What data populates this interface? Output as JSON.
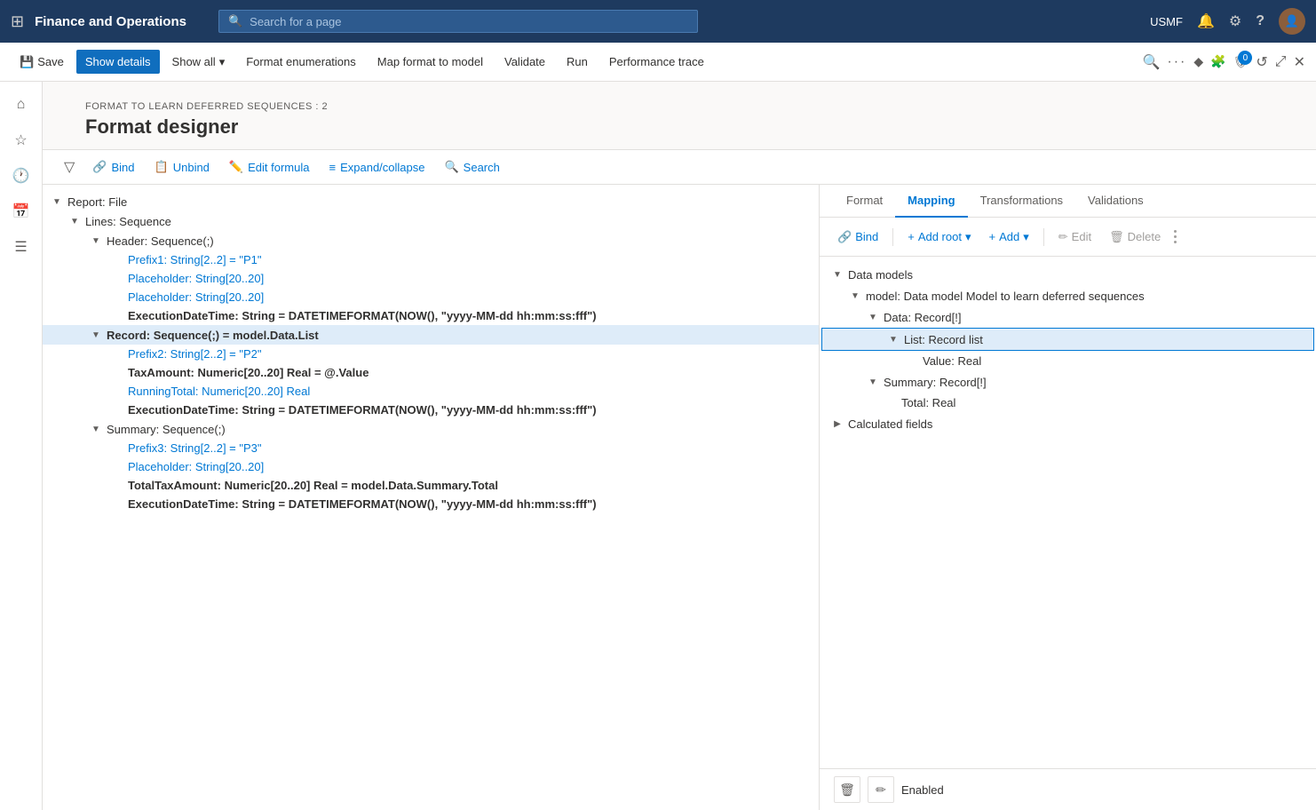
{
  "app": {
    "title": "Finance and Operations",
    "search_placeholder": "Search for a page",
    "user_code": "USMF"
  },
  "command_bar": {
    "save": "Save",
    "show_details": "Show details",
    "show_all": "Show all",
    "format_enumerations": "Format enumerations",
    "map_format_to_model": "Map format to model",
    "validate": "Validate",
    "run": "Run",
    "performance_trace": "Performance trace"
  },
  "breadcrumb": "FORMAT TO LEARN DEFERRED SEQUENCES : 2",
  "page_title": "Format designer",
  "toolbar": {
    "bind": "Bind",
    "unbind": "Unbind",
    "edit_formula": "Edit formula",
    "expand_collapse": "Expand/collapse",
    "search": "Search"
  },
  "format_tree": [
    {
      "id": "report",
      "label": "Report: File",
      "indent": 0,
      "collapsed": false,
      "bold": false,
      "children": [
        {
          "id": "lines",
          "label": "Lines: Sequence",
          "indent": 1,
          "collapsed": false,
          "children": [
            {
              "id": "header",
              "label": "Header: Sequence(;)",
              "indent": 2,
              "collapsed": false,
              "children": [
                {
                  "id": "prefix1",
                  "label": "Prefix1: String[2..2] = \"P1\"",
                  "indent": 3,
                  "leaf": true,
                  "blue": true
                },
                {
                  "id": "placeholder1",
                  "label": "Placeholder: String[20..20]",
                  "indent": 3,
                  "leaf": true,
                  "blue": true
                },
                {
                  "id": "placeholder2",
                  "label": "Placeholder: String[20..20]",
                  "indent": 3,
                  "leaf": true,
                  "blue": true
                },
                {
                  "id": "execdate1",
                  "label": "ExecutionDateTime: String = DATETIMEFORMAT(NOW(), \"yyyy-MM-dd hh:mm:ss:fff\")",
                  "indent": 3,
                  "leaf": true,
                  "bold": true
                }
              ]
            },
            {
              "id": "record",
              "label": "Record: Sequence(;) = model.Data.List",
              "indent": 2,
              "collapsed": false,
              "selected": true,
              "children": [
                {
                  "id": "prefix2",
                  "label": "Prefix2: String[2..2] = \"P2\"",
                  "indent": 3,
                  "leaf": true,
                  "blue": true
                },
                {
                  "id": "taxamount",
                  "label": "TaxAmount: Numeric[20..20] Real = @.Value",
                  "indent": 3,
                  "leaf": true,
                  "bold": true
                },
                {
                  "id": "runningtotal",
                  "label": "RunningTotal: Numeric[20..20] Real",
                  "indent": 3,
                  "leaf": true,
                  "blue": true
                },
                {
                  "id": "execdate2",
                  "label": "ExecutionDateTime: String = DATETIMEFORMAT(NOW(), \"yyyy-MM-dd hh:mm:ss:fff\")",
                  "indent": 3,
                  "leaf": true,
                  "bold": true
                }
              ]
            },
            {
              "id": "summary",
              "label": "Summary: Sequence(;)",
              "indent": 2,
              "collapsed": false,
              "children": [
                {
                  "id": "prefix3",
                  "label": "Prefix3: String[2..2] = \"P3\"",
                  "indent": 3,
                  "leaf": true,
                  "blue": true
                },
                {
                  "id": "placeholder3",
                  "label": "Placeholder: String[20..20]",
                  "indent": 3,
                  "leaf": true,
                  "blue": true
                },
                {
                  "id": "totaltax",
                  "label": "TotalTaxAmount: Numeric[20..20] Real = model.Data.Summary.Total",
                  "indent": 3,
                  "leaf": true,
                  "bold": true
                },
                {
                  "id": "execdate3",
                  "label": "ExecutionDateTime: String = DATETIMEFORMAT(NOW(), \"yyyy-MM-dd hh:mm:ss:fff\")",
                  "indent": 3,
                  "leaf": true,
                  "bold": true
                }
              ]
            }
          ]
        }
      ]
    }
  ],
  "mapping_tabs": [
    "Format",
    "Mapping",
    "Transformations",
    "Validations"
  ],
  "active_mapping_tab": "Mapping",
  "mapping_toolbar": {
    "bind": "Bind",
    "add_root": "Add root",
    "add": "Add",
    "edit": "Edit",
    "delete": "Delete"
  },
  "mapping_tree": [
    {
      "id": "data_models",
      "label": "Data models",
      "indent": 0,
      "collapsed": false,
      "children": [
        {
          "id": "model",
          "label": "model: Data model Model to learn deferred sequences",
          "indent": 1,
          "collapsed": false,
          "children": [
            {
              "id": "data",
              "label": "Data: Record[!]",
              "indent": 2,
              "collapsed": false,
              "children": [
                {
                  "id": "list",
                  "label": "List: Record list",
                  "indent": 3,
                  "highlighted": true,
                  "children": [
                    {
                      "id": "value",
                      "label": "Value: Real",
                      "indent": 4,
                      "leaf": true
                    }
                  ]
                }
              ]
            },
            {
              "id": "summary_model",
              "label": "Summary: Record[!]",
              "indent": 2,
              "collapsed": false,
              "children": [
                {
                  "id": "total",
                  "label": "Total: Real",
                  "indent": 3,
                  "leaf": true
                }
              ]
            }
          ]
        }
      ]
    },
    {
      "id": "calculated_fields",
      "label": "Calculated fields",
      "indent": 0,
      "collapsed": true
    }
  ],
  "status": {
    "enabled": "Enabled"
  },
  "icons": {
    "grid": "⊞",
    "save": "💾",
    "search": "🔍",
    "bind": "🔗",
    "unbind": "📋",
    "formula": "✏️",
    "expand": "≡",
    "chevron_down": "▾",
    "chevron_right": "▶",
    "collapse": "◀",
    "bell": "🔔",
    "gear": "⚙",
    "help": "?",
    "home": "⌂",
    "star": "☆",
    "history": "🕐",
    "calendar": "📅",
    "list": "☰",
    "filter": "▽",
    "add": "+",
    "edit": "✏",
    "delete": "🗑",
    "more": "···",
    "diamond": "◆",
    "puzzle": "🧩",
    "shield": "🛡",
    "refresh": "↺",
    "expand_window": "⤢",
    "close": "✕",
    "badge_count": "0"
  }
}
